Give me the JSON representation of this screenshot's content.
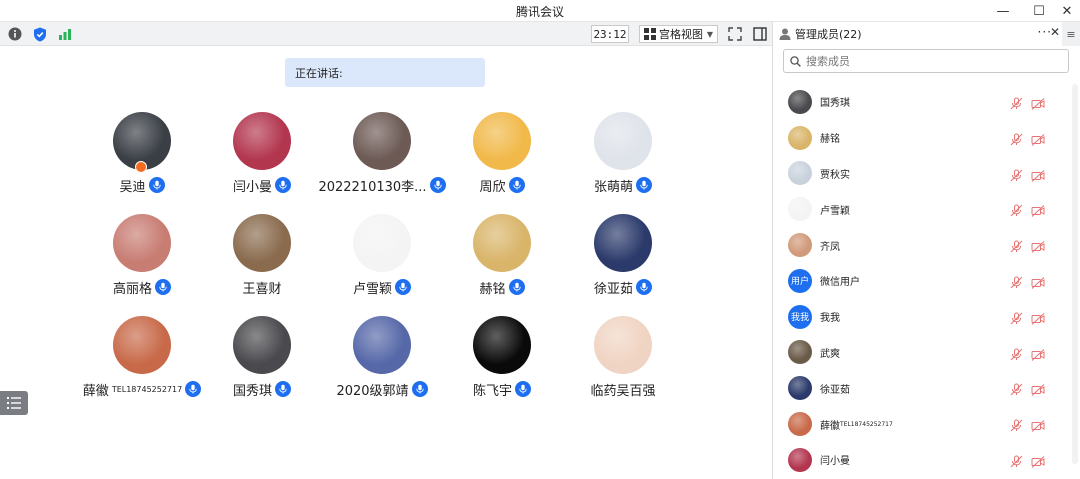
{
  "window": {
    "title": "腾讯会议",
    "minimize_glyph": "—",
    "maximize_glyph": "☐",
    "close_glyph": "✕"
  },
  "toolbar": {
    "info_icon": "info-icon",
    "shield_icon": "shield-icon",
    "signal_icon": "signal-icon",
    "timer": "23:12",
    "view_label": "宫格视图",
    "fullscreen_icon": "fullscreen-icon",
    "sidebar_icon": "sidebar-toggle-icon"
  },
  "speaking": {
    "label": "正在讲话:"
  },
  "participants": [
    {
      "name": "吴迪",
      "mic": true,
      "host": true,
      "color": "#3a3f46"
    },
    {
      "name": "闫小曼",
      "mic": true,
      "color": "#b3364f"
    },
    {
      "name": "2022210130李...",
      "mic": true,
      "color": "#6d5a55"
    },
    {
      "name": "周欣",
      "mic": true,
      "color": "#f1b94a"
    },
    {
      "name": "张萌萌",
      "mic": true,
      "color": "#dfe3ea"
    },
    {
      "name": "高丽格",
      "mic": true,
      "color": "#c87d73"
    },
    {
      "name": "王喜财",
      "mic": false,
      "color": "#8a6b4e"
    },
    {
      "name": "卢雪颖",
      "mic": true,
      "color": "#f4f4f4"
    },
    {
      "name": "赫铭",
      "mic": true,
      "color": "#d9b56a"
    },
    {
      "name": "徐亚茹",
      "mic": true,
      "color": "#2b3a6b"
    },
    {
      "name": "薛徽",
      "name_sup": "TEL18745252717",
      "mic": true,
      "color": "#c86a4a"
    },
    {
      "name": "国秀琪",
      "mic": true,
      "color": "#4a4a4e"
    },
    {
      "name": "2020级郭靖",
      "mic": true,
      "color": "#5668a8"
    },
    {
      "name": "陈飞宇",
      "mic": true,
      "color": "#0a0a0a"
    },
    {
      "name": "临药吴百强",
      "mic": false,
      "color": "#f0d4c3"
    }
  ],
  "panel": {
    "title": "管理成员(22)",
    "more_glyph": "···",
    "close_glyph": "✕",
    "menu_glyph": "≡",
    "search_placeholder": "搜索成员",
    "members": [
      {
        "name": "国秀琪",
        "color": "#4a4a4e"
      },
      {
        "name": "赫铭",
        "color": "#d9b56a"
      },
      {
        "name": "贾秋实",
        "color": "#c9d2dc"
      },
      {
        "name": "卢雪颖",
        "color": "#f4f4f4"
      },
      {
        "name": "齐凤",
        "color": "#d19a7a"
      },
      {
        "name": "微信用户",
        "avatar_text": "用户",
        "color": "#1e6ff0"
      },
      {
        "name": "我我",
        "avatar_text": "我我",
        "color": "#1e6ff0"
      },
      {
        "name": "武爽",
        "color": "#6a5a48"
      },
      {
        "name": "徐亚茹",
        "color": "#2b3a6b"
      },
      {
        "name": "薛徽",
        "name_sup": "TEL18745252717",
        "color": "#c86a4a"
      },
      {
        "name": "闫小曼",
        "color": "#b3364f"
      }
    ]
  },
  "colors": {
    "accent": "#1e6ff0",
    "speaking_bg": "#dbe8fb",
    "muted_red": "#e57373",
    "host_orange": "#f56a21"
  }
}
